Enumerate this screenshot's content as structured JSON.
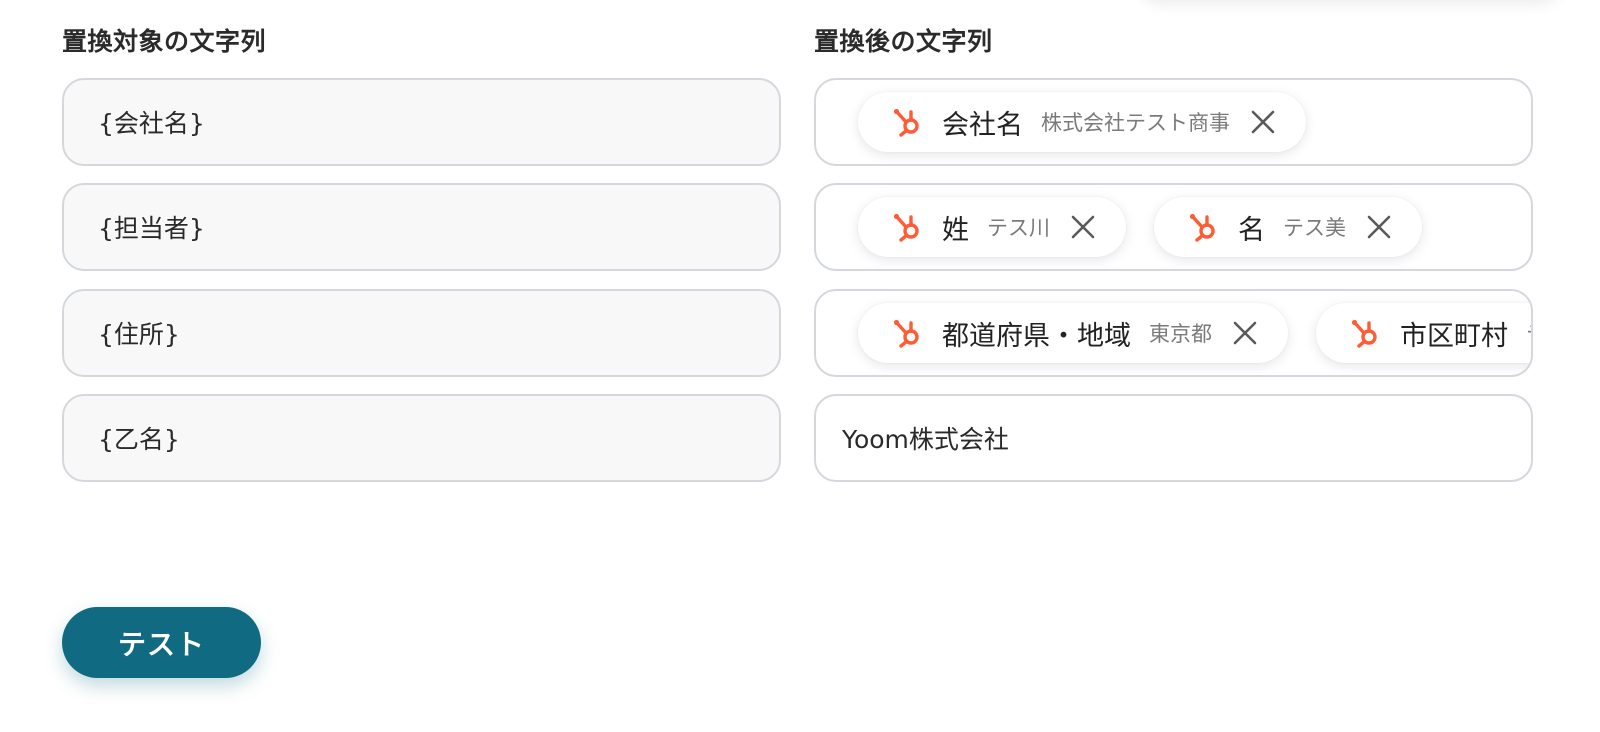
{
  "labels": {
    "target": "置換対象の文字列",
    "replacement": "置換後の文字列"
  },
  "rows": [
    {
      "target": "{会社名}",
      "chips": [
        {
          "name": "会社名",
          "value": "株式会社テスト商事"
        }
      ]
    },
    {
      "target": "{担当者}",
      "chips": [
        {
          "name": "姓",
          "value": "テス川"
        },
        {
          "name": "名",
          "value": "テス美"
        }
      ]
    },
    {
      "target": "{住所}",
      "chips": [
        {
          "name": "都道府県・地域",
          "value": "東京都"
        },
        {
          "name": "市区町村",
          "value": "テ"
        }
      ]
    },
    {
      "target": "{乙名}",
      "replacement_text": "Yoom株式会社"
    }
  ],
  "test_button_label": "テスト",
  "colors": {
    "accent": "#0f6a82",
    "hubspot_orange": "#ff5c35",
    "field_border": "#d4d8dd",
    "field_bg_left": "#f8f8f8"
  },
  "icons": {
    "chip_icon": "hubspot-icon",
    "chip_close": "close-icon"
  }
}
